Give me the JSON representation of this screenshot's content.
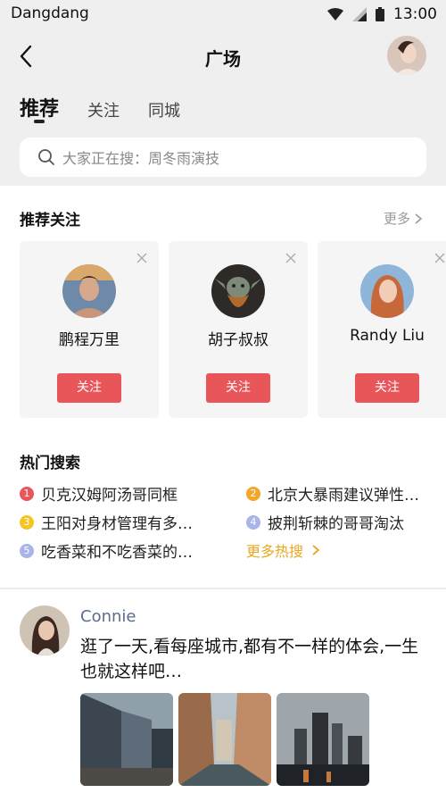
{
  "status_bar": {
    "carrier": "Dangdang",
    "time": "13:00"
  },
  "nav": {
    "title": "广场",
    "back_icon": "back-arrow-icon"
  },
  "tabs": [
    {
      "label": "推荐",
      "active": true
    },
    {
      "label": "关注",
      "active": false
    },
    {
      "label": "同城",
      "active": false
    }
  ],
  "search": {
    "placeholder": "大家正在搜：周冬雨演技"
  },
  "recommend": {
    "title": "推荐关注",
    "more": "更多",
    "cards": [
      {
        "name": "鹏程万里",
        "follow": "关注"
      },
      {
        "name": "胡子叔叔",
        "follow": "关注"
      },
      {
        "name": "Randy Liu",
        "follow": "关注"
      }
    ]
  },
  "hot": {
    "title": "热门搜索",
    "items": [
      {
        "rank": "1",
        "text": "贝克汉姆阿汤哥同框",
        "color": "#e8565a"
      },
      {
        "rank": "2",
        "text": "北京大暴雨建议弹性…",
        "color": "#f0a72a"
      },
      {
        "rank": "3",
        "text": "王阳对身材管理有多…",
        "color": "#f3c623"
      },
      {
        "rank": "4",
        "text": "披荆斩棘的哥哥淘汰",
        "color": "#a9b4e8"
      },
      {
        "rank": "5",
        "text": "吃香菜和不吃香菜的…",
        "color": "#a9b4e8"
      }
    ],
    "more": "更多热搜"
  },
  "post": {
    "user": "Connie",
    "text": "逛了一天,看每座城市,都有不一样的体会,一生也就这样吧…"
  },
  "colors": {
    "accent": "#e8565a",
    "hot_more": "#e8a71e",
    "username": "#5b6c8e"
  }
}
